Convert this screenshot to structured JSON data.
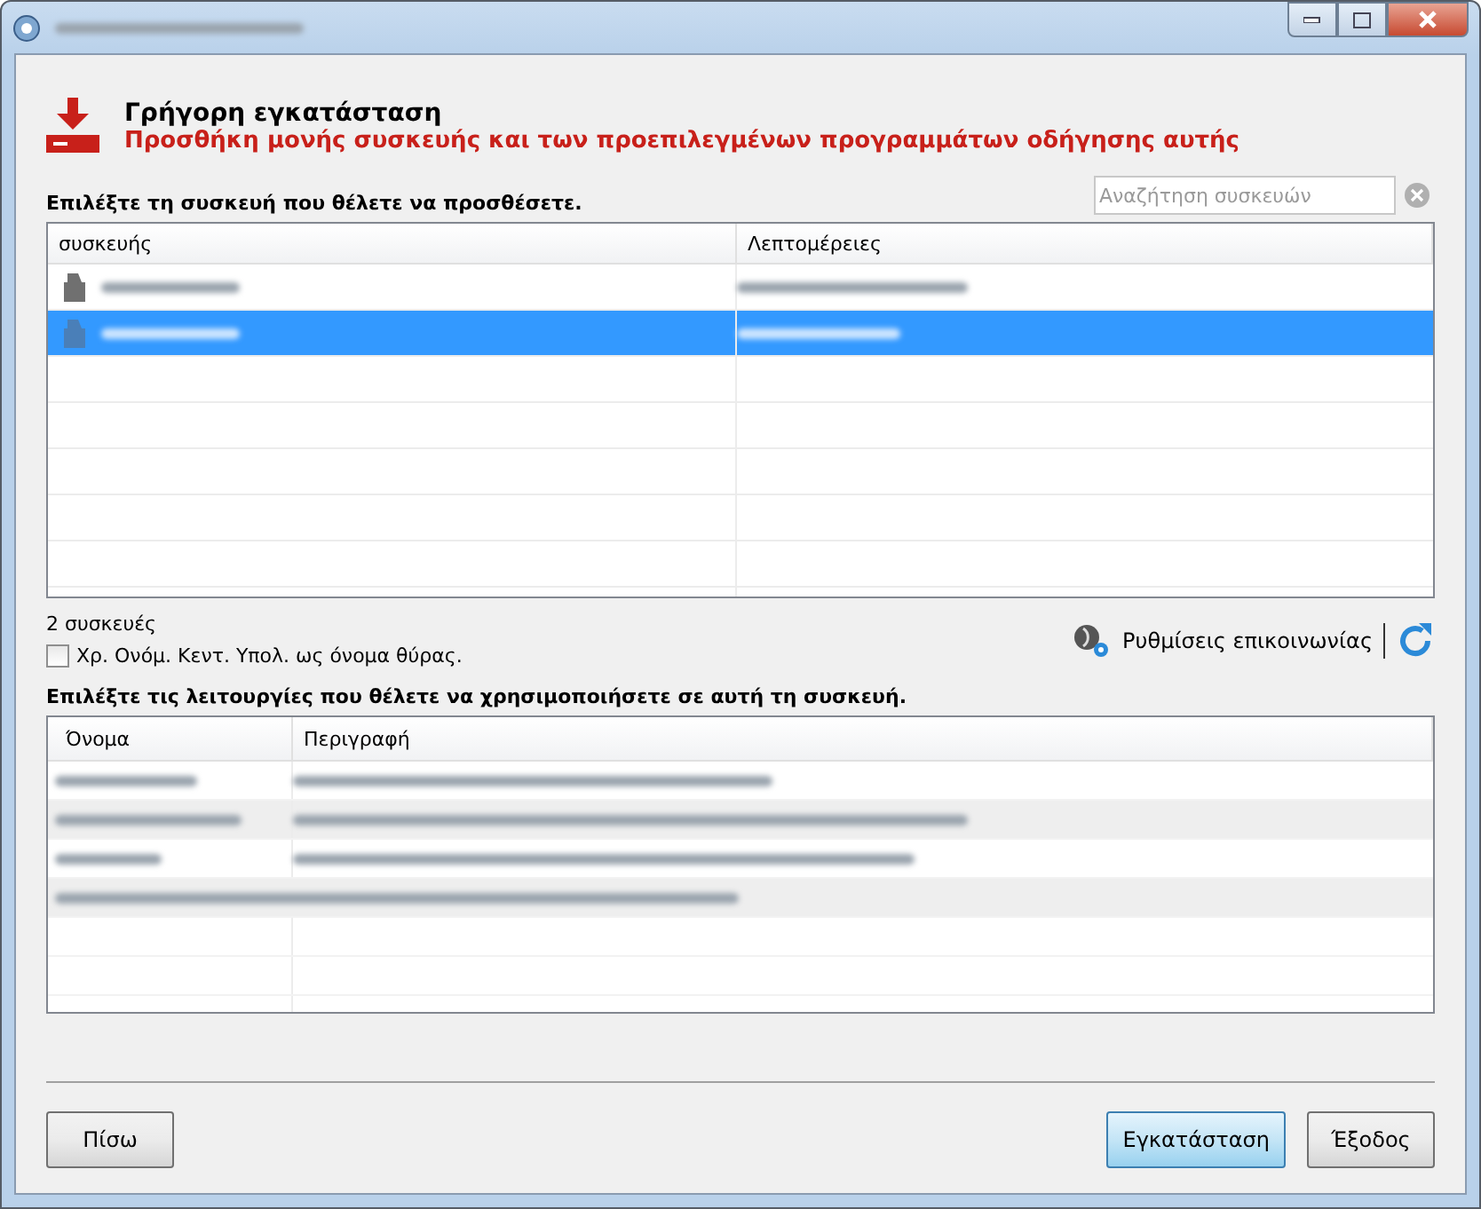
{
  "header": {
    "title": "Γρήγορη εγκατάσταση",
    "subtitle": "Προσθήκη μονής συσκευής και των προεπιλεγμένων προγραμμάτων οδήγησης αυτής"
  },
  "device_prompt": "Επιλέξτε τη συσκευή που θέλετε να προσθέσετε.",
  "search": {
    "placeholder": "Αναζήτηση συσκευών"
  },
  "devices_table": {
    "columns": [
      "συσκευής",
      "Λεπτομέρειες"
    ],
    "rows": [
      {
        "selected": false
      },
      {
        "selected": true
      }
    ]
  },
  "device_count": "2 συσκευές",
  "hostname_option": {
    "label": "Χρ. Ονόμ. Κεντ. Υπολ. ως όνομα θύρας.",
    "checked": false
  },
  "comm_settings": "Ρυθμίσεις επικοινωνίας",
  "function_prompt": "Επιλέξτε τις λειτουργίες που θέλετε να χρησιμοποιήσετε σε αυτή τη συσκευή.",
  "functions_table": {
    "columns": [
      "Όνομα",
      "Περιγραφή"
    ],
    "rows": [
      {
        "kind": "redacted"
      },
      {
        "kind": "redacted"
      },
      {
        "kind": "redacted"
      },
      {
        "kind": "redacted"
      }
    ]
  },
  "buttons": {
    "back": "Πίσω",
    "install": "Εγκατάσταση",
    "exit": "Έξοδος"
  }
}
